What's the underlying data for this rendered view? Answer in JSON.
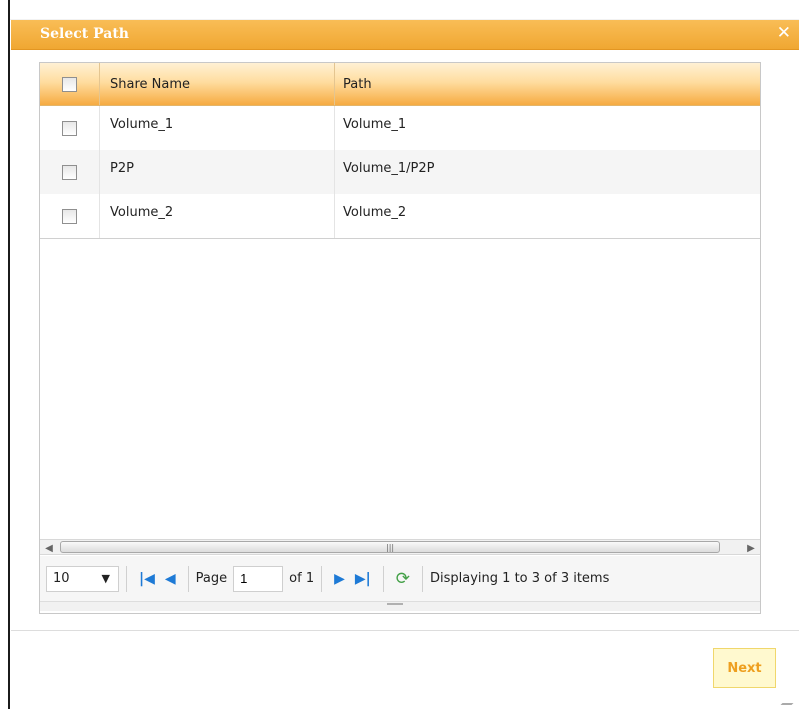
{
  "dialog": {
    "title": "Select Path",
    "close_icon": "✕"
  },
  "grid": {
    "columns": [
      "Share Name",
      "Path"
    ],
    "rows": [
      {
        "share_name": "Volume_1",
        "path": "Volume_1"
      },
      {
        "share_name": "P2P",
        "path": "Volume_1/P2P"
      },
      {
        "share_name": "Volume_2",
        "path": "Volume_2"
      }
    ]
  },
  "pager": {
    "page_size": "10",
    "page_label": "Page",
    "page_value": "1",
    "of_label": "of 1",
    "display_text": "Displaying 1 to 3 of 3 items"
  },
  "buttons": {
    "next_label": "Next"
  }
}
